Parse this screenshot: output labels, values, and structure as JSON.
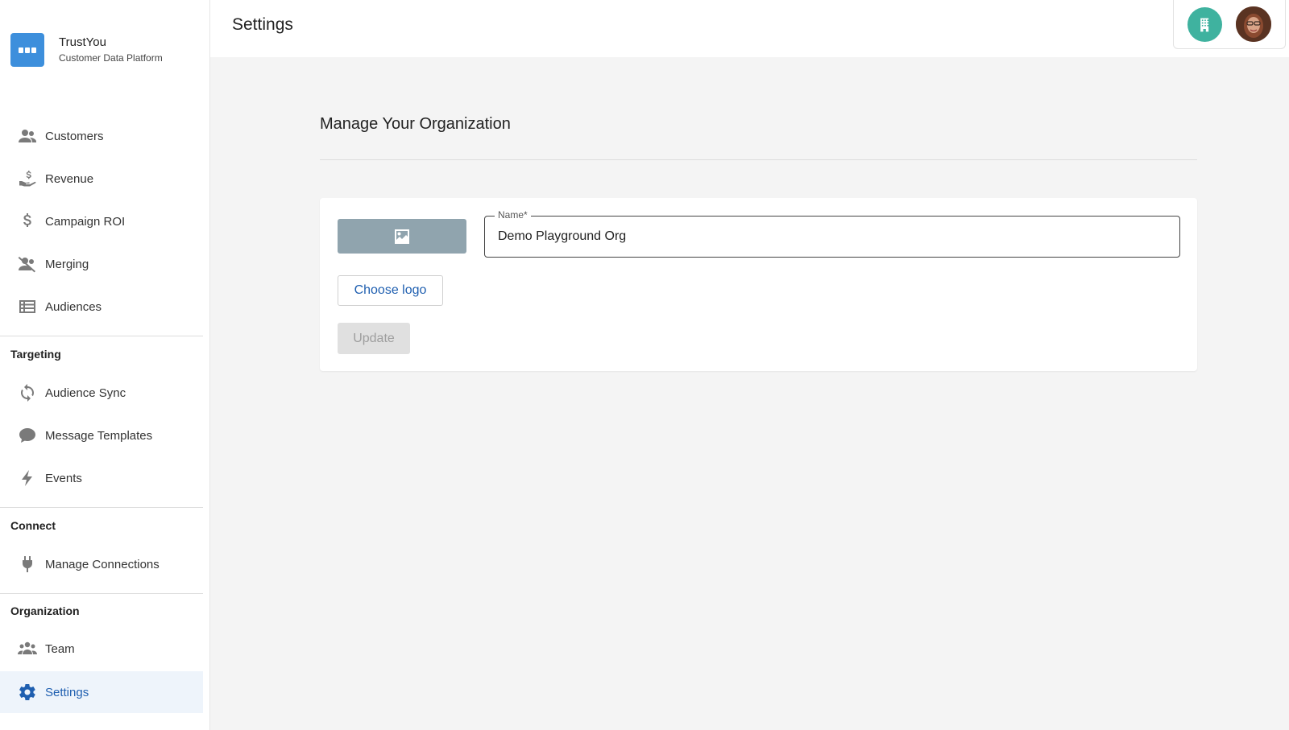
{
  "brand": {
    "name": "TrustYou",
    "subtitle": "Customer Data Platform",
    "logo_icon": "chat-bubble-icon",
    "color": "#3d8fdc"
  },
  "header": {
    "title": "Settings",
    "org_icon": "building-icon",
    "org_color": "#3fb29f"
  },
  "sidebar": {
    "main_items": [
      {
        "label": "Customers",
        "icon": "people-icon"
      },
      {
        "label": "Revenue",
        "icon": "hand-dollar-icon"
      },
      {
        "label": "Campaign ROI",
        "icon": "dollar-icon"
      },
      {
        "label": "Merging",
        "icon": "people-off-icon"
      },
      {
        "label": "Audiences",
        "icon": "list-icon"
      }
    ],
    "targeting": {
      "heading": "Targeting",
      "items": [
        {
          "label": "Audience Sync",
          "icon": "sync-icon"
        },
        {
          "label": "Message Templates",
          "icon": "chat-icon"
        },
        {
          "label": "Events",
          "icon": "bolt-icon"
        }
      ]
    },
    "connect": {
      "heading": "Connect",
      "items": [
        {
          "label": "Manage Connections",
          "icon": "plug-icon"
        }
      ]
    },
    "organization": {
      "heading": "Organization",
      "items": [
        {
          "label": "Team",
          "icon": "group-icon"
        },
        {
          "label": "Settings",
          "icon": "gear-icon",
          "active": true
        }
      ]
    },
    "active_color": "#1f5fb0"
  },
  "main": {
    "section_title": "Manage Your Organization",
    "name_field": {
      "label": "Name*",
      "value": "Demo Playground Org"
    },
    "logo_placeholder_icon": "image-icon",
    "choose_logo_label": "Choose logo",
    "update_label": "Update"
  }
}
